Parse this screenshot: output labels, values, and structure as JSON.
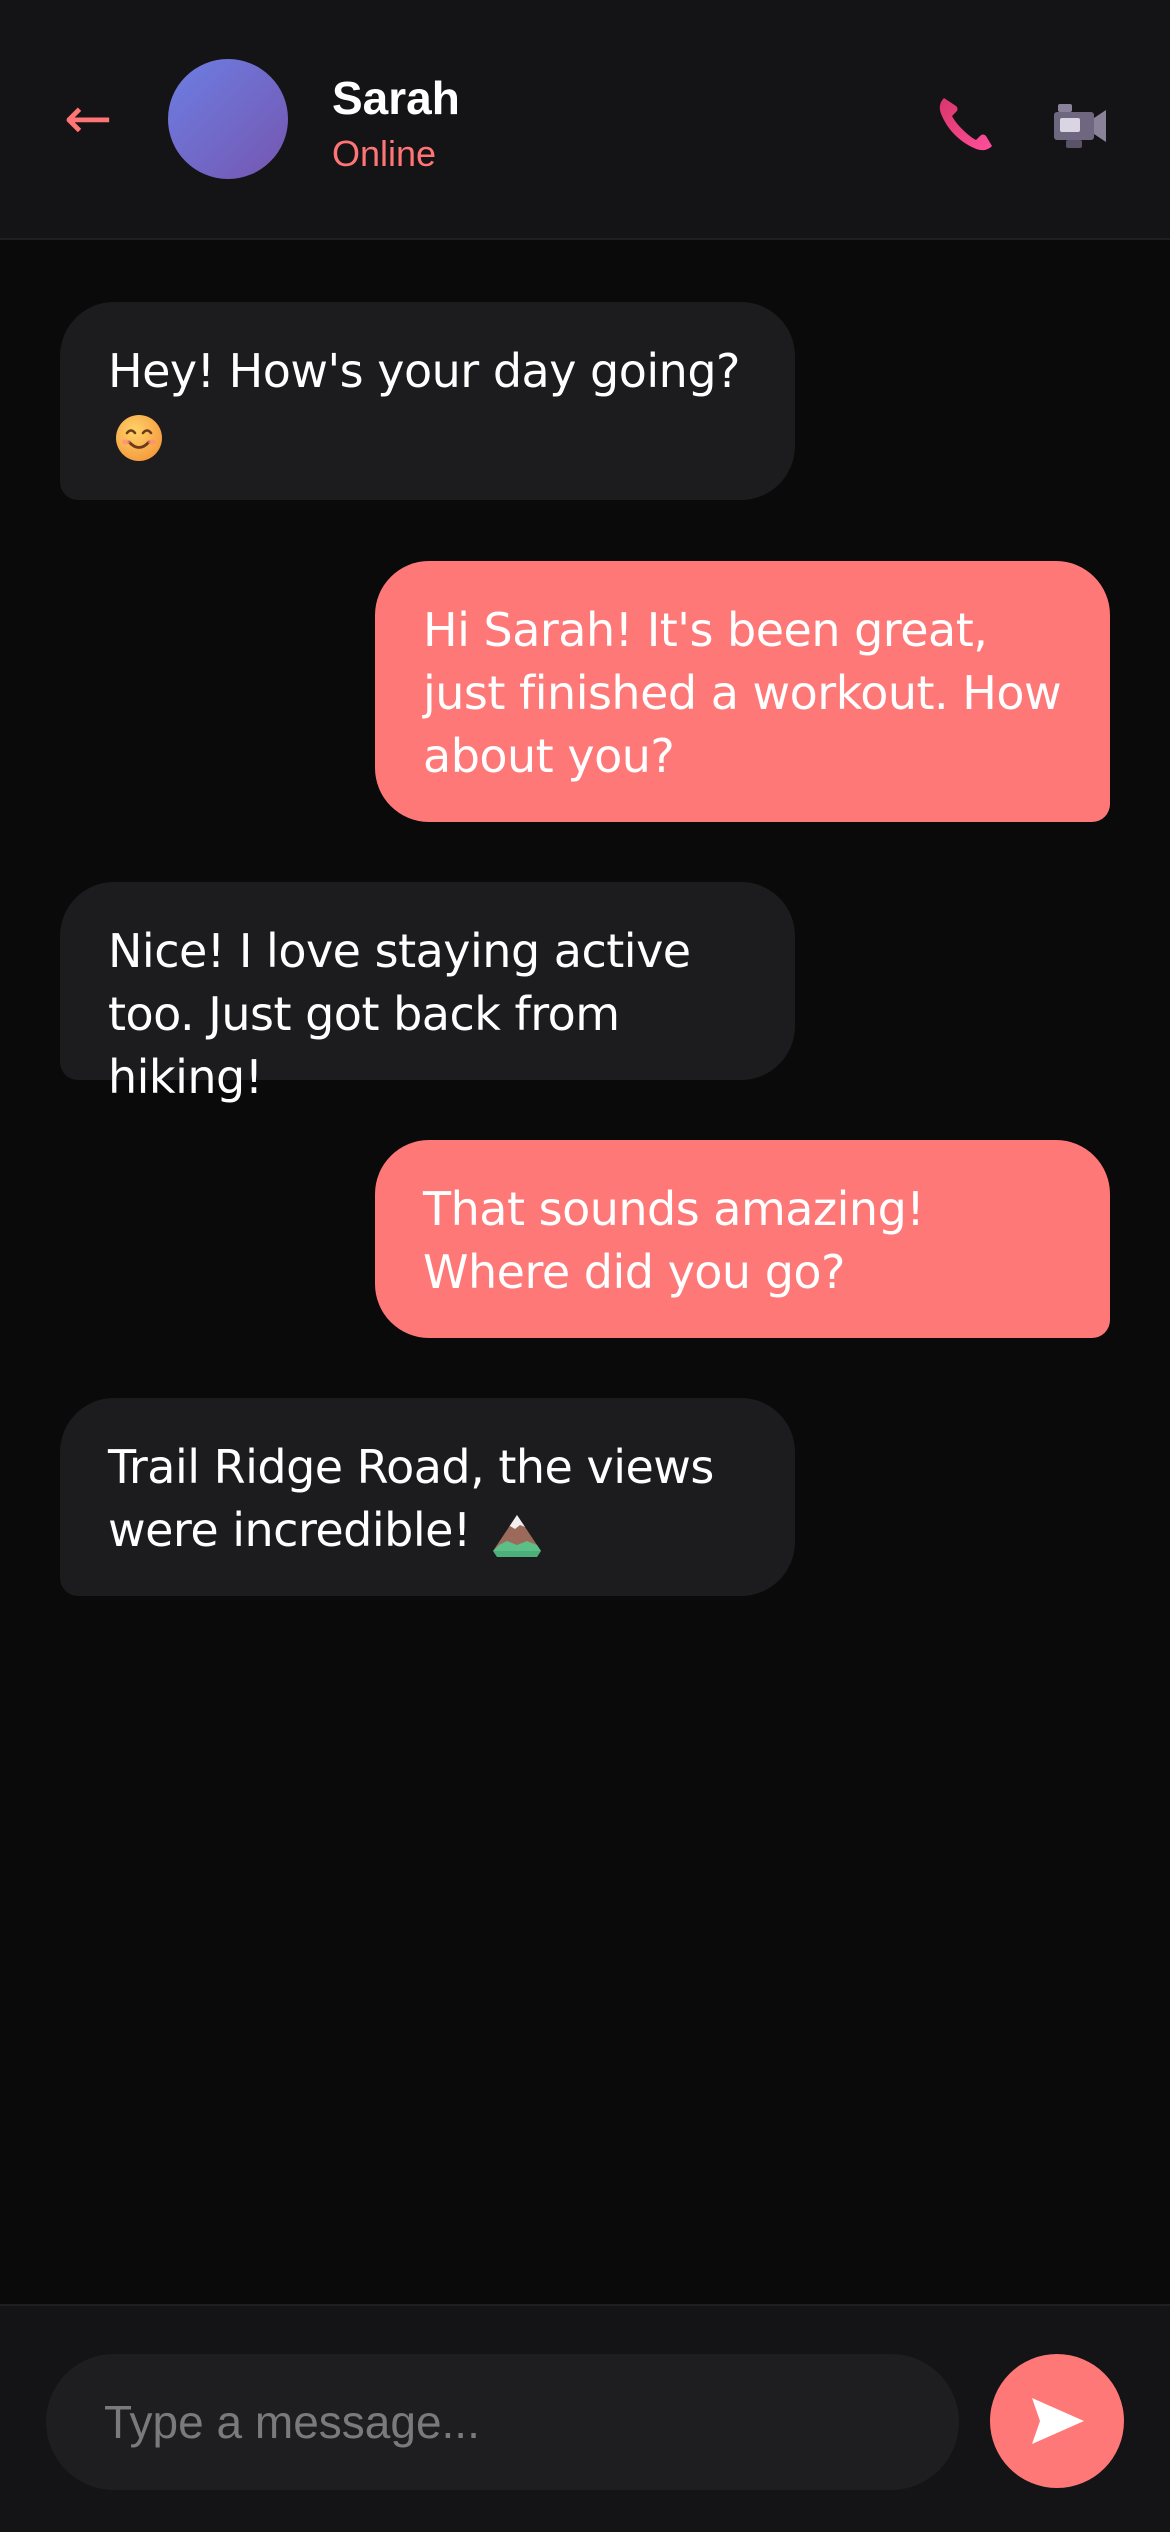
{
  "header": {
    "back_icon": "arrow-left-icon",
    "back_glyph": "←",
    "contact_name": "Sarah",
    "status": "Online",
    "call_icon": "phone-icon",
    "video_icon": "video-camera-icon"
  },
  "messages": [
    {
      "direction": "incoming",
      "text": "Hey! How's your day going?",
      "emoji": "smiling-face-emoji"
    },
    {
      "direction": "outgoing",
      "text": "Hi Sarah! It's been great, just finished a workout. How about you?"
    },
    {
      "direction": "incoming",
      "text": "Nice! I love staying active too. Just got back from hiking!"
    },
    {
      "direction": "outgoing",
      "text": "That sounds amazing! Where did you go?"
    },
    {
      "direction": "incoming",
      "text": "Trail Ridge Road, the views were incredible!",
      "emoji": "mountain-emoji"
    }
  ],
  "composer": {
    "placeholder": "Type a message...",
    "value": "",
    "send_icon": "send-icon"
  },
  "colors": {
    "accent": "#ff7878",
    "background": "#0a0a0a",
    "header_bg": "#141416",
    "incoming_bubble": "#1c1c1e"
  }
}
